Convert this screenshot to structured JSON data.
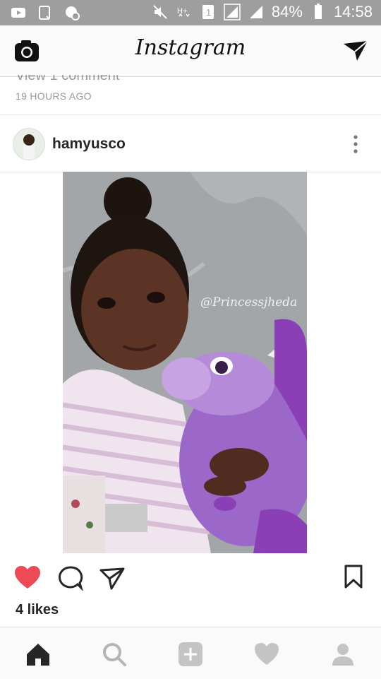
{
  "status_bar": {
    "battery": "84%",
    "time": "14:58"
  },
  "app": {
    "title": "Instagram"
  },
  "previous_post": {
    "comment_link": "View 1 comment",
    "timestamp": "19 HOURS AGO"
  },
  "post": {
    "username": "hamyusco",
    "watermark": "@Princessjheda",
    "likes": "4 likes",
    "liked": true
  },
  "icons": {
    "camera": "camera-icon",
    "direct": "paper-plane-icon",
    "more": "vertical-dots-icon",
    "like": "heart-icon",
    "comment": "comment-bubble-icon",
    "share": "paper-plane-icon",
    "save": "bookmark-icon",
    "home": "home-icon",
    "search": "search-icon",
    "add": "plus-icon",
    "activity": "heart-icon",
    "profile": "person-icon"
  },
  "colors": {
    "like_red": "#ed4956",
    "status_bar_bg": "#9e9e9e",
    "text": "#262626",
    "muted": "#999999"
  }
}
